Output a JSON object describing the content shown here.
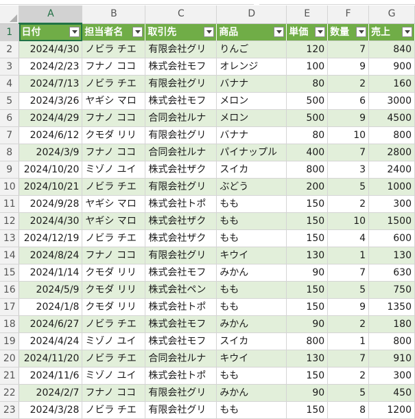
{
  "columns": [
    "A",
    "B",
    "C",
    "D",
    "E",
    "F",
    "G"
  ],
  "active_column": "A",
  "active_row": "1",
  "header_row": [
    "日付",
    "担当者名",
    "取引先",
    "商品",
    "単価",
    "数量",
    "売上"
  ],
  "rows": [
    {
      "num": "2",
      "date": "2024/4/30",
      "person": "ノビラ チエ",
      "client": "有限会社グリ",
      "product": "りんご",
      "price": "120",
      "qty": "7",
      "sales": "840"
    },
    {
      "num": "3",
      "date": "2024/2/23",
      "person": "フナノ ココ",
      "client": "株式会社モフ",
      "product": "オレンジ",
      "price": "100",
      "qty": "9",
      "sales": "900"
    },
    {
      "num": "4",
      "date": "2024/7/13",
      "person": "ノビラ チエ",
      "client": "有限会社グリ",
      "product": "バナナ",
      "price": "80",
      "qty": "2",
      "sales": "160"
    },
    {
      "num": "5",
      "date": "2024/3/26",
      "person": "ヤギシ マロ",
      "client": "株式会社モフ",
      "product": "メロン",
      "price": "500",
      "qty": "6",
      "sales": "3000"
    },
    {
      "num": "6",
      "date": "2024/4/29",
      "person": "フナノ ココ",
      "client": "合同会社ルナ",
      "product": "メロン",
      "price": "500",
      "qty": "9",
      "sales": "4500"
    },
    {
      "num": "7",
      "date": "2024/6/12",
      "person": "クモダ リリ",
      "client": "有限会社グリ",
      "product": "バナナ",
      "price": "80",
      "qty": "10",
      "sales": "800"
    },
    {
      "num": "8",
      "date": "2024/3/9",
      "person": "フナノ ココ",
      "client": "合同会社ルナ",
      "product": "パイナップル",
      "price": "400",
      "qty": "7",
      "sales": "2800"
    },
    {
      "num": "9",
      "date": "2024/10/20",
      "person": "ミゾノ ユイ",
      "client": "株式会社ザク",
      "product": "スイカ",
      "price": "800",
      "qty": "3",
      "sales": "2400"
    },
    {
      "num": "10",
      "date": "2024/10/21",
      "person": "ノビラ チエ",
      "client": "有限会社グリ",
      "product": "ぶどう",
      "price": "200",
      "qty": "5",
      "sales": "1000"
    },
    {
      "num": "11",
      "date": "2024/9/28",
      "person": "ヤギシ マロ",
      "client": "株式会社トポ",
      "product": "もも",
      "price": "150",
      "qty": "2",
      "sales": "300"
    },
    {
      "num": "12",
      "date": "2024/4/30",
      "person": "ヤギシ マロ",
      "client": "株式会社ザク",
      "product": "もも",
      "price": "150",
      "qty": "10",
      "sales": "1500"
    },
    {
      "num": "13",
      "date": "2024/12/19",
      "person": "ノビラ チエ",
      "client": "株式会社ザク",
      "product": "もも",
      "price": "150",
      "qty": "4",
      "sales": "600"
    },
    {
      "num": "14",
      "date": "2024/8/24",
      "person": "フナノ ココ",
      "client": "有限会社グリ",
      "product": "キウイ",
      "price": "130",
      "qty": "1",
      "sales": "130"
    },
    {
      "num": "15",
      "date": "2024/1/14",
      "person": "クモダ リリ",
      "client": "株式会社モフ",
      "product": "みかん",
      "price": "90",
      "qty": "7",
      "sales": "630"
    },
    {
      "num": "16",
      "date": "2024/5/9",
      "person": "クモダ リリ",
      "client": "株式会社ペン",
      "product": "もも",
      "price": "150",
      "qty": "5",
      "sales": "750"
    },
    {
      "num": "17",
      "date": "2024/1/8",
      "person": "クモダ リリ",
      "client": "株式会社トポ",
      "product": "もも",
      "price": "150",
      "qty": "9",
      "sales": "1350"
    },
    {
      "num": "18",
      "date": "2024/6/27",
      "person": "ノビラ チエ",
      "client": "株式会社モフ",
      "product": "みかん",
      "price": "90",
      "qty": "2",
      "sales": "180"
    },
    {
      "num": "19",
      "date": "2024/4/24",
      "person": "ミゾノ ユイ",
      "client": "株式会社モフ",
      "product": "スイカ",
      "price": "800",
      "qty": "1",
      "sales": "800"
    },
    {
      "num": "20",
      "date": "2024/11/20",
      "person": "ノビラ チエ",
      "client": "合同会社ルナ",
      "product": "キウイ",
      "price": "130",
      "qty": "7",
      "sales": "910"
    },
    {
      "num": "21",
      "date": "2024/11/6",
      "person": "ミゾノ ユイ",
      "client": "株式会社トポ",
      "product": "もも",
      "price": "150",
      "qty": "2",
      "sales": "300"
    },
    {
      "num": "22",
      "date": "2024/2/7",
      "person": "フナノ ココ",
      "client": "有限会社グリ",
      "product": "みかん",
      "price": "90",
      "qty": "5",
      "sales": "450"
    },
    {
      "num": "23",
      "date": "2024/3/28",
      "person": "ノビラ チエ",
      "client": "有限会社グリ",
      "product": "もも",
      "price": "150",
      "qty": "8",
      "sales": "1200"
    }
  ],
  "colors": {
    "header_fill": "#70ad47",
    "band_fill": "#e2efda",
    "selection": "#217346"
  }
}
